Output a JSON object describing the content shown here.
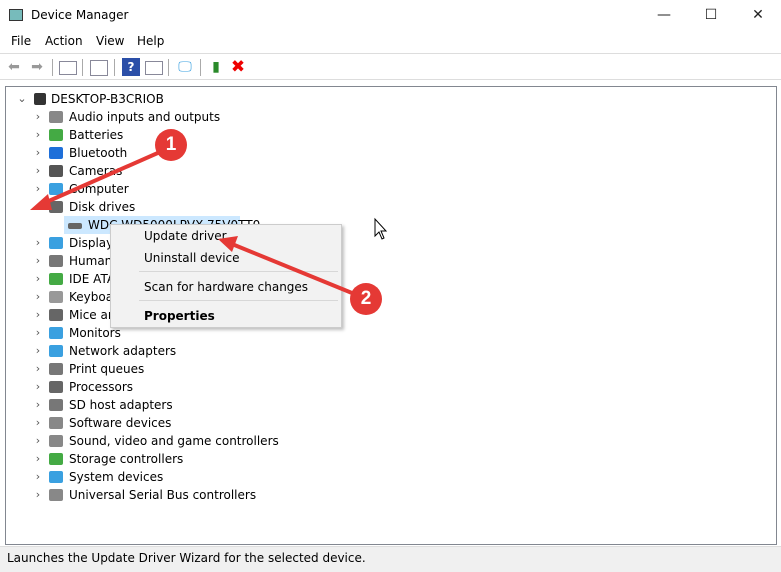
{
  "window": {
    "title": "Device Manager",
    "minimize": "—",
    "maximize": "☐",
    "close": "✕"
  },
  "menu": [
    "File",
    "Action",
    "View",
    "Help"
  ],
  "toolbar": {
    "icons": [
      "back-icon",
      "forward-icon",
      "show-hide-console-tree-icon",
      "properties-icon",
      "help-icon",
      "action-pane-icon",
      "scan-hardware-icon",
      "update-driver-icon",
      "uninstall-icon"
    ]
  },
  "tree": {
    "root": "DESKTOP-B3CRIOB",
    "items": [
      {
        "label": "Audio inputs and outputs",
        "color": "#888"
      },
      {
        "label": "Batteries",
        "color": "#4a4"
      },
      {
        "label": "Bluetooth",
        "color": "#1e6fd9"
      },
      {
        "label": "Cameras",
        "color": "#555"
      },
      {
        "label": "Computer",
        "color": "#3aa0e0"
      },
      {
        "label": "Disk drives",
        "color": "#666",
        "expanded": true,
        "children": [
          "WDC WD5000LPVX-75V0TT0"
        ]
      },
      {
        "label": "Display adapters",
        "color": "#3aa0e0"
      },
      {
        "label": "Human Interface Devices",
        "color": "#777"
      },
      {
        "label": "IDE ATA/ATAPI controllers",
        "color": "#4a4"
      },
      {
        "label": "Keyboards",
        "color": "#999"
      },
      {
        "label": "Mice and other pointing devices",
        "color": "#666"
      },
      {
        "label": "Monitors",
        "color": "#3aa0e0"
      },
      {
        "label": "Network adapters",
        "color": "#3aa0e0"
      },
      {
        "label": "Print queues",
        "color": "#777"
      },
      {
        "label": "Processors",
        "color": "#666"
      },
      {
        "label": "SD host adapters",
        "color": "#777"
      },
      {
        "label": "Software devices",
        "color": "#888"
      },
      {
        "label": "Sound, video and game controllers",
        "color": "#888"
      },
      {
        "label": "Storage controllers",
        "color": "#4a4"
      },
      {
        "label": "System devices",
        "color": "#3aa0e0"
      },
      {
        "label": "Universal Serial Bus controllers",
        "color": "#888"
      }
    ]
  },
  "context_menu": {
    "update": "Update driver",
    "uninstall": "Uninstall device",
    "scan": "Scan for hardware changes",
    "properties": "Properties"
  },
  "annotations": {
    "one": "1",
    "two": "2",
    "color": "#e53935"
  },
  "status": "Launches the Update Driver Wizard for the selected device."
}
